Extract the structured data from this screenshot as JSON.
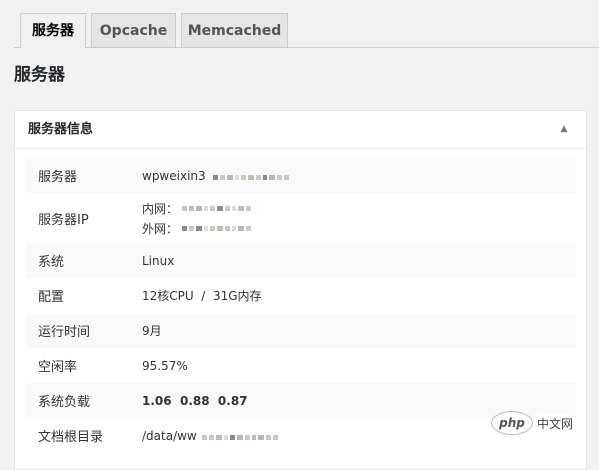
{
  "tabs": [
    {
      "label": "服务器",
      "active": true
    },
    {
      "label": "Opcache",
      "active": false
    },
    {
      "label": "Memcached",
      "active": false
    }
  ],
  "page_title": "服务器",
  "panel": {
    "title": "服务器信息",
    "toggle_icon": "triangle-up",
    "rows": [
      {
        "label": "服务器",
        "value": "wpweixin3"
      },
      {
        "label": "服务器IP",
        "internal_label": "内网：",
        "external_label": "外网："
      },
      {
        "label": "系统",
        "value": "Linux"
      },
      {
        "label": "配置",
        "value": "12核CPU  /  31G内存"
      },
      {
        "label": "运行时间",
        "value": "9月"
      },
      {
        "label": "空闲率",
        "value": "95.57%"
      },
      {
        "label": "系统负载",
        "value": "1.06  0.88  0.87"
      },
      {
        "label": "文档根目录",
        "value": "/data/ww"
      }
    ]
  },
  "watermark": {
    "logo": "php",
    "text": "中文网"
  },
  "colors": {
    "background": "#f1f1f1",
    "panel": "#ffffff",
    "row_alt": "#f9f9f9",
    "border": "#cccccc"
  }
}
